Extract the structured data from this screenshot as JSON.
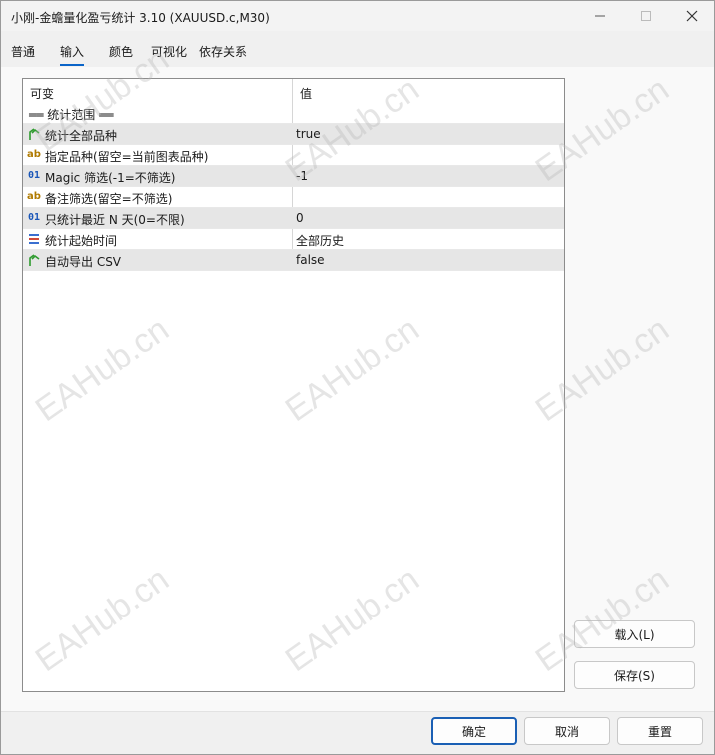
{
  "window": {
    "title": "小刚-金蟾量化盈亏统计 3.10 (XAUUSD.c,M30)"
  },
  "tabs": [
    {
      "label": "普通"
    },
    {
      "label": "输入"
    },
    {
      "label": "颜色"
    },
    {
      "label": "可视化"
    },
    {
      "label": "依存关系"
    }
  ],
  "grid": {
    "header_name": "可变",
    "header_value": "值",
    "section_label": "══ 统计范围 ══",
    "rows": [
      {
        "icon": "bool-icon",
        "name": "统计全部品种",
        "value": "true"
      },
      {
        "icon": "string-icon",
        "icon_text": "ab",
        "name": "指定品种(留空=当前图表品种)",
        "value": ""
      },
      {
        "icon": "int-icon",
        "icon_text": "01",
        "name": "Magic 筛选(-1=不筛选)",
        "value": "-1"
      },
      {
        "icon": "string-icon",
        "icon_text": "ab",
        "name": "备注筛选(留空=不筛选)",
        "value": ""
      },
      {
        "icon": "int-icon",
        "icon_text": "01",
        "name": "只统计最近 N 天(0=不限)",
        "value": "0"
      },
      {
        "icon": "enum-icon",
        "name": "统计起始时间",
        "value": "全部历史"
      },
      {
        "icon": "bool-icon",
        "name": "自动导出 CSV",
        "value": "false"
      }
    ]
  },
  "side_buttons": {
    "load": "载入(L)",
    "save": "保存(S)"
  },
  "footer": {
    "ok": "确定",
    "cancel": "取消",
    "reset": "重置"
  },
  "watermark_text": "EAHub.cn",
  "colors": {
    "accent": "#0a64c8",
    "row_shade": "#e6e6e6",
    "bool_icon": "#2e9b2e",
    "string_icon": "#b07a00",
    "int_icon": "#1a56b8"
  }
}
